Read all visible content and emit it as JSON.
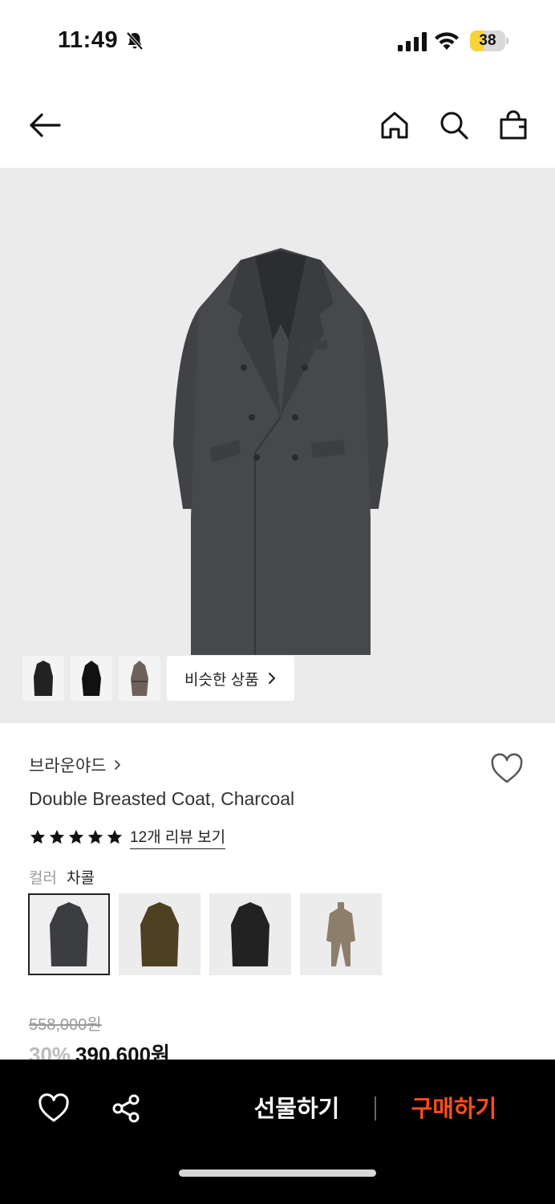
{
  "status_bar": {
    "time": "11:49",
    "battery": "38",
    "battery_level": 0.38,
    "icons": [
      "bell-off-icon",
      "cellular-signal-icon",
      "wifi-icon",
      "battery-icon"
    ]
  },
  "header": {
    "icons": [
      "back-arrow-icon",
      "home-icon",
      "search-icon",
      "shopping-bag-icon"
    ]
  },
  "hero": {
    "similar_label": "비슷한 상품",
    "thumbnails": [
      "coat-thumb-1",
      "coat-thumb-2",
      "coat-thumb-3"
    ]
  },
  "product": {
    "brand": "브라운야드",
    "title": "Double Breasted Coat, Charcoal",
    "rating_stars": 5,
    "review_link": "12개 리뷰 보기",
    "color_label": "컬러",
    "color_value": "차콜",
    "colors": [
      {
        "name": "charcoal",
        "hex": "#3b3d40",
        "selected": true
      },
      {
        "name": "olive",
        "hex": "#4e4122",
        "selected": false
      },
      {
        "name": "black",
        "hex": "#222222",
        "selected": false
      },
      {
        "name": "beige",
        "hex": "#8c7e6b",
        "selected": false
      }
    ],
    "original_price": "558,000원",
    "discount": "30%",
    "sale_price": "390,600원"
  },
  "bottom_bar": {
    "gift_label": "선물하기",
    "buy_label": "구매하기",
    "buy_color": "#ff4e1a"
  }
}
